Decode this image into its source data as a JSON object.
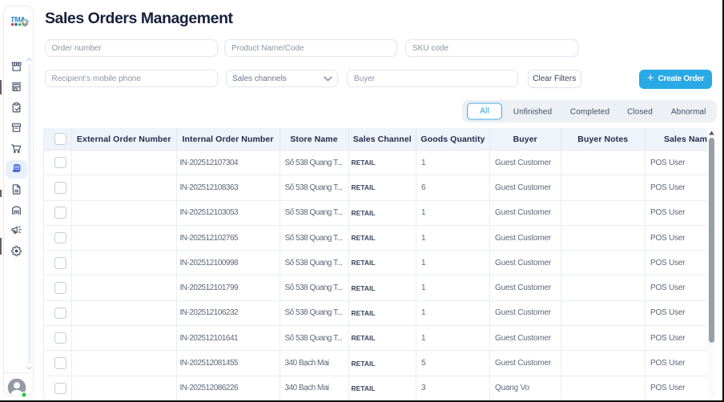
{
  "window": {
    "title": "Sales Orders Management"
  },
  "logo": {
    "text": "TMA",
    "dot_colors": [
      "#e53238",
      "#1b7ac0",
      "#3aa435"
    ]
  },
  "sidebar": {
    "items": [
      {
        "id": "storefront",
        "icon": "storefront-icon",
        "active": false
      },
      {
        "id": "kiosk",
        "icon": "kiosk-icon",
        "active": false
      },
      {
        "id": "tasks",
        "icon": "clipboard-check-icon",
        "active": false
      },
      {
        "id": "inventory",
        "icon": "archive-box-icon",
        "active": false
      },
      {
        "id": "purchases",
        "icon": "cart-icon",
        "active": false
      },
      {
        "id": "orders",
        "icon": "receipt-icon",
        "active": true
      },
      {
        "id": "documents",
        "icon": "document-icon",
        "active": false
      },
      {
        "id": "warehouse",
        "icon": "warehouse-icon",
        "active": false
      },
      {
        "id": "marketing",
        "icon": "megaphone-icon",
        "active": false
      },
      {
        "id": "settings",
        "icon": "gear-icon",
        "active": false
      }
    ],
    "avatar": {
      "status": "online",
      "status_color": "#2fc24a"
    }
  },
  "filters": {
    "order_number_placeholder": "Order number",
    "product_placeholder": "Product Name/Code",
    "sku_placeholder": "SKU code",
    "phone_placeholder": "Recipient's mobile phone",
    "sales_channels_label": "Sales channels",
    "buyer_placeholder": "Buyer",
    "clear_button": "Clear Filters",
    "create_button": "Create Order",
    "create_plus": "+"
  },
  "tabs": {
    "items": [
      "All",
      "Unfinished",
      "Completed",
      "Closed",
      "Abnormal"
    ],
    "active": "All"
  },
  "table": {
    "columns": [
      "",
      "External Order Number",
      "Internal Order Number",
      "Store Name",
      "Sales Channel",
      "Goods Quantity",
      "Buyer",
      "Buyer Notes",
      "Sales Name"
    ],
    "rows": [
      {
        "external": "",
        "internal": "IN-202512107304",
        "store": "Số 538 Quang T...",
        "channel": "RETAIL",
        "qty": "1",
        "buyer": "Guest Customer",
        "notes": "",
        "sales": "POS User"
      },
      {
        "external": "",
        "internal": "IN-202512108363",
        "store": "Số 538 Quang T...",
        "channel": "RETAIL",
        "qty": "6",
        "buyer": "Guest Customer",
        "notes": "",
        "sales": "POS User"
      },
      {
        "external": "",
        "internal": "IN-202512103053",
        "store": "Số 538 Quang T...",
        "channel": "RETAIL",
        "qty": "1",
        "buyer": "Guest Customer",
        "notes": "",
        "sales": "POS User"
      },
      {
        "external": "",
        "internal": "IN-202512102765",
        "store": "Số 538 Quang T...",
        "channel": "RETAIL",
        "qty": "1",
        "buyer": "Guest Customer",
        "notes": "",
        "sales": "POS User"
      },
      {
        "external": "",
        "internal": "IN-202512100998",
        "store": "Số 538 Quang T...",
        "channel": "RETAIL",
        "qty": "1",
        "buyer": "Guest Customer",
        "notes": "",
        "sales": "POS User"
      },
      {
        "external": "",
        "internal": "IN-202512101799",
        "store": "Số 538 Quang T...",
        "channel": "RETAIL",
        "qty": "1",
        "buyer": "Guest Customer",
        "notes": "",
        "sales": "POS User"
      },
      {
        "external": "",
        "internal": "IN-202512106232",
        "store": "Số 538 Quang T...",
        "channel": "RETAIL",
        "qty": "1",
        "buyer": "Guest Customer",
        "notes": "",
        "sales": "POS User"
      },
      {
        "external": "",
        "internal": "IN-202512101641",
        "store": "Số 538 Quang T...",
        "channel": "RETAIL",
        "qty": "1",
        "buyer": "Guest Customer",
        "notes": "",
        "sales": "POS User"
      },
      {
        "external": "",
        "internal": "IN-202512081455",
        "store": "340 Bạch Mai",
        "channel": "RETAIL",
        "qty": "5",
        "buyer": "Guest Customer",
        "notes": "",
        "sales": "POS User"
      },
      {
        "external": "",
        "internal": "IN-202512086226",
        "store": "340 Bạch Mai",
        "channel": "RETAIL",
        "qty": "3",
        "buyer": "Quang Vo",
        "notes": "",
        "sales": "POS User"
      }
    ]
  },
  "colors": {
    "accent": "#29a9e5",
    "active_icon": "#3d5ce5"
  }
}
